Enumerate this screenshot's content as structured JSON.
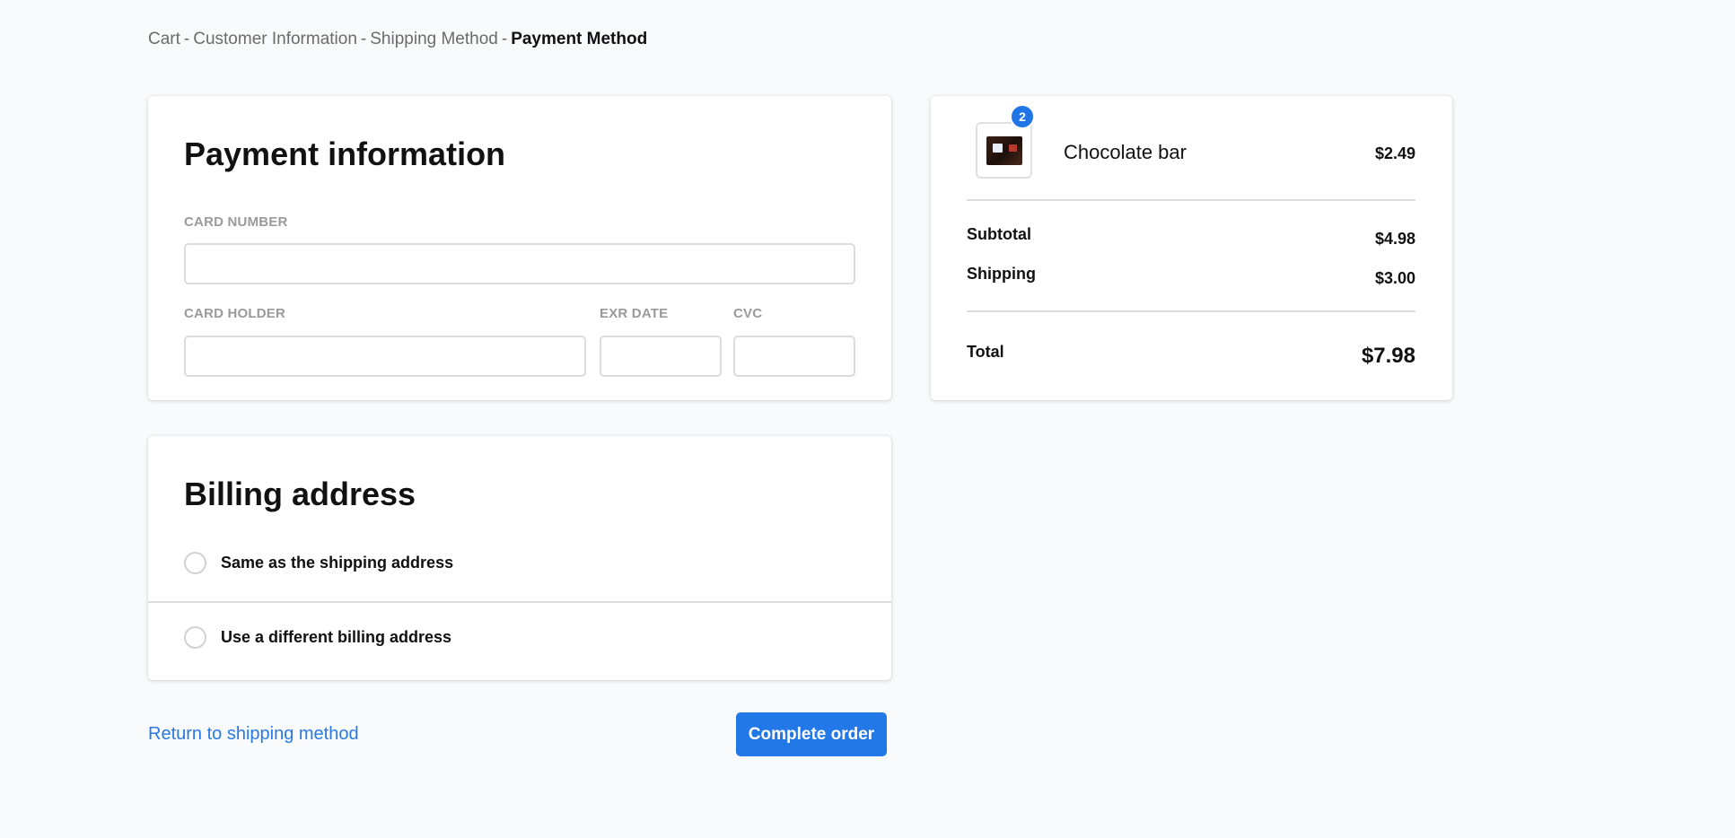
{
  "breadcrumb": {
    "steps": [
      "Cart",
      "Customer Information",
      "Shipping Method"
    ],
    "separator": "-",
    "current": "Payment Method"
  },
  "payment": {
    "title": "Payment information",
    "card_number_label": "CARD NUMBER",
    "card_holder_label": "CARD HOLDER",
    "exp_date_label": "EXR DATE",
    "cvc_label": "CVC"
  },
  "billing": {
    "title": "Billing address",
    "options": [
      "Same as the shipping address",
      "Use a different billing address"
    ]
  },
  "actions": {
    "return_label": "Return to shipping method",
    "complete_label": "Complete order"
  },
  "summary": {
    "item": {
      "name": "Chocolate bar",
      "price": "$2.49",
      "quantity": "2",
      "icon": "chocolate-bar-image"
    },
    "subtotal_label": "Subtotal",
    "subtotal_value": "$4.98",
    "shipping_label": "Shipping",
    "shipping_value": "$3.00",
    "total_label": "Total",
    "total_value": "$7.98"
  },
  "colors": {
    "accent": "#2378e8",
    "link": "#2a7ae2",
    "background": "#f8fafc"
  }
}
